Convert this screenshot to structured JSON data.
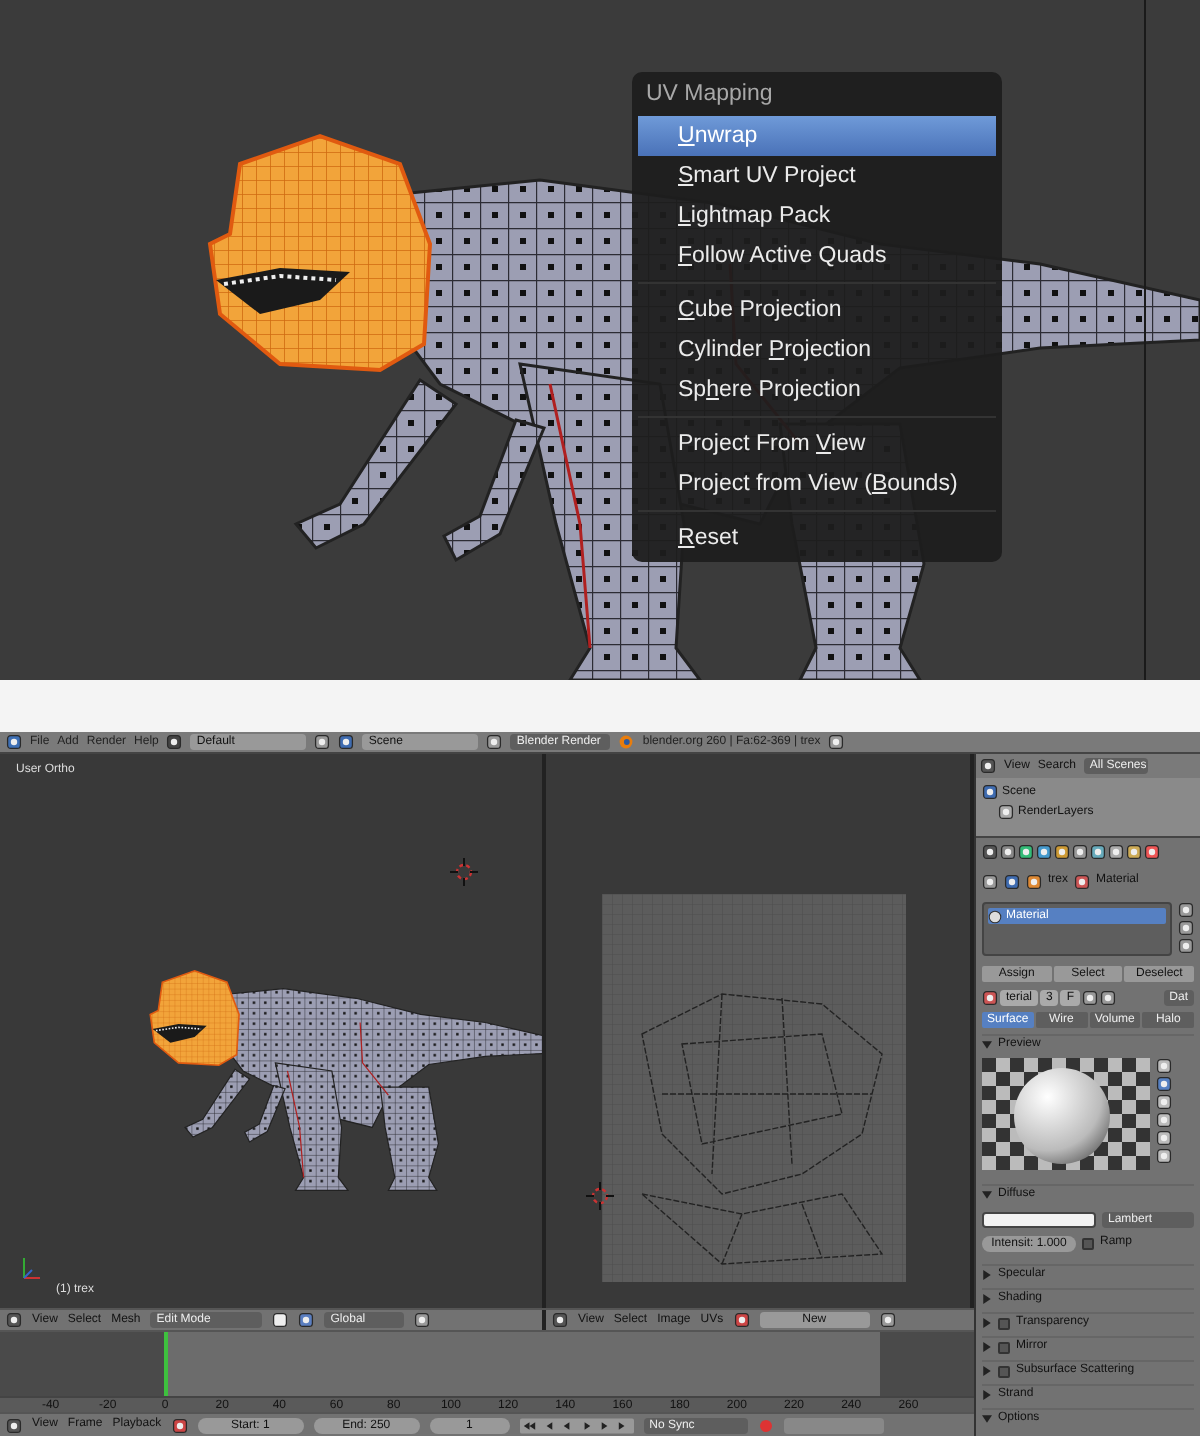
{
  "top_view": {
    "menu": {
      "title": "UV Mapping",
      "groups": [
        [
          {
            "key": "U",
            "after": "nwrap",
            "selected": true
          },
          {
            "key": "S",
            "after": "mart UV Project",
            "selected": false
          },
          {
            "key": "L",
            "after": "ightmap Pack",
            "selected": false
          },
          {
            "key": "F",
            "after": "ollow Active Quads",
            "selected": false
          }
        ],
        [
          {
            "key": "C",
            "after": "ube Projection",
            "selected": false
          },
          {
            "before": "Cylinder ",
            "key": "P",
            "after": "rojection",
            "selected": false
          },
          {
            "before": "Sp",
            "key": "h",
            "after": "ere Projection",
            "selected": false
          }
        ],
        [
          {
            "before": "Project From ",
            "key": "V",
            "after": "iew",
            "selected": false
          },
          {
            "before": "Project from View (",
            "key": "B",
            "after": "ounds)",
            "selected": false
          }
        ],
        [
          {
            "key": "R",
            "after": "eset",
            "selected": false
          }
        ]
      ]
    }
  },
  "info_header": {
    "menus": [
      "File",
      "Add",
      "Render",
      "Help"
    ],
    "screen_layout": "Default",
    "scene": "Scene",
    "render_engine": "Blender Render",
    "status": "blender.org 260 | Fa:62-369 | trex"
  },
  "viewport": {
    "label": "User Ortho",
    "object_label": "(1) trex"
  },
  "viewport_header": {
    "menus": [
      "View",
      "Select",
      "Mesh"
    ],
    "mode": "Edit Mode",
    "orientation": "Global"
  },
  "uv_header": {
    "menus": [
      "View",
      "Select",
      "Image",
      "UVs"
    ],
    "new_button": "New"
  },
  "timeline": {
    "ticks": [
      {
        "label": "-40",
        "current": false
      },
      {
        "label": "-20",
        "current": false
      },
      {
        "label": "0",
        "current": true
      },
      {
        "label": "20",
        "current": false
      },
      {
        "label": "40",
        "current": false
      },
      {
        "label": "60",
        "current": false
      },
      {
        "label": "80",
        "current": false
      },
      {
        "label": "100",
        "current": false
      },
      {
        "label": "120",
        "current": false
      },
      {
        "label": "140",
        "current": false
      },
      {
        "label": "160",
        "current": false
      },
      {
        "label": "180",
        "current": false
      },
      {
        "label": "200",
        "current": false
      },
      {
        "label": "220",
        "current": false
      },
      {
        "label": "240",
        "current": false
      },
      {
        "label": "260",
        "current": false
      }
    ]
  },
  "timeline_header": {
    "menus": [
      "View",
      "Frame",
      "Playback"
    ],
    "start": "Start: 1",
    "end": "End: 250",
    "frame": "1",
    "sync": "No Sync"
  },
  "outliner_header": {
    "menus": [
      "View",
      "Search"
    ],
    "display": "All Scenes"
  },
  "outliner": {
    "items": [
      {
        "label": "Scene",
        "children": [
          {
            "label": "RenderLayers"
          }
        ]
      }
    ]
  },
  "properties": {
    "breadcrumb": [
      "trex",
      "Material"
    ],
    "material_slots": [
      {
        "label": "Material",
        "selected": true
      }
    ],
    "slot_buttons": [
      "Assign",
      "Select",
      "Deselect"
    ],
    "material_name": "terial",
    "users": "3",
    "fake_user": "F",
    "link": "Dat",
    "type_tabs": [
      {
        "label": "Surface",
        "selected": true
      },
      {
        "label": "Wire",
        "selected": false
      },
      {
        "label": "Volume",
        "selected": false
      },
      {
        "label": "Halo",
        "selected": false
      }
    ],
    "panels": [
      {
        "title": "Preview",
        "expanded": true,
        "kind": "preview"
      },
      {
        "title": "Diffuse",
        "expanded": true,
        "kind": "diffuse",
        "shader": "Lambert",
        "intensity": "Intensit: 1.000",
        "ramp": {
          "label": "Ramp",
          "checked": false
        }
      },
      {
        "title": "Specular",
        "expanded": false,
        "kind": "plain"
      },
      {
        "title": "Shading",
        "expanded": false,
        "kind": "plain"
      },
      {
        "title": "Transparency",
        "expanded": false,
        "kind": "toggle",
        "checked": false
      },
      {
        "title": "Mirror",
        "expanded": false,
        "kind": "toggle",
        "checked": false
      },
      {
        "title": "Subsurface Scattering",
        "expanded": false,
        "kind": "toggle",
        "checked": false
      },
      {
        "title": "Strand",
        "expanded": false,
        "kind": "plain"
      },
      {
        "title": "Options",
        "expanded": true,
        "kind": "plain"
      }
    ]
  }
}
